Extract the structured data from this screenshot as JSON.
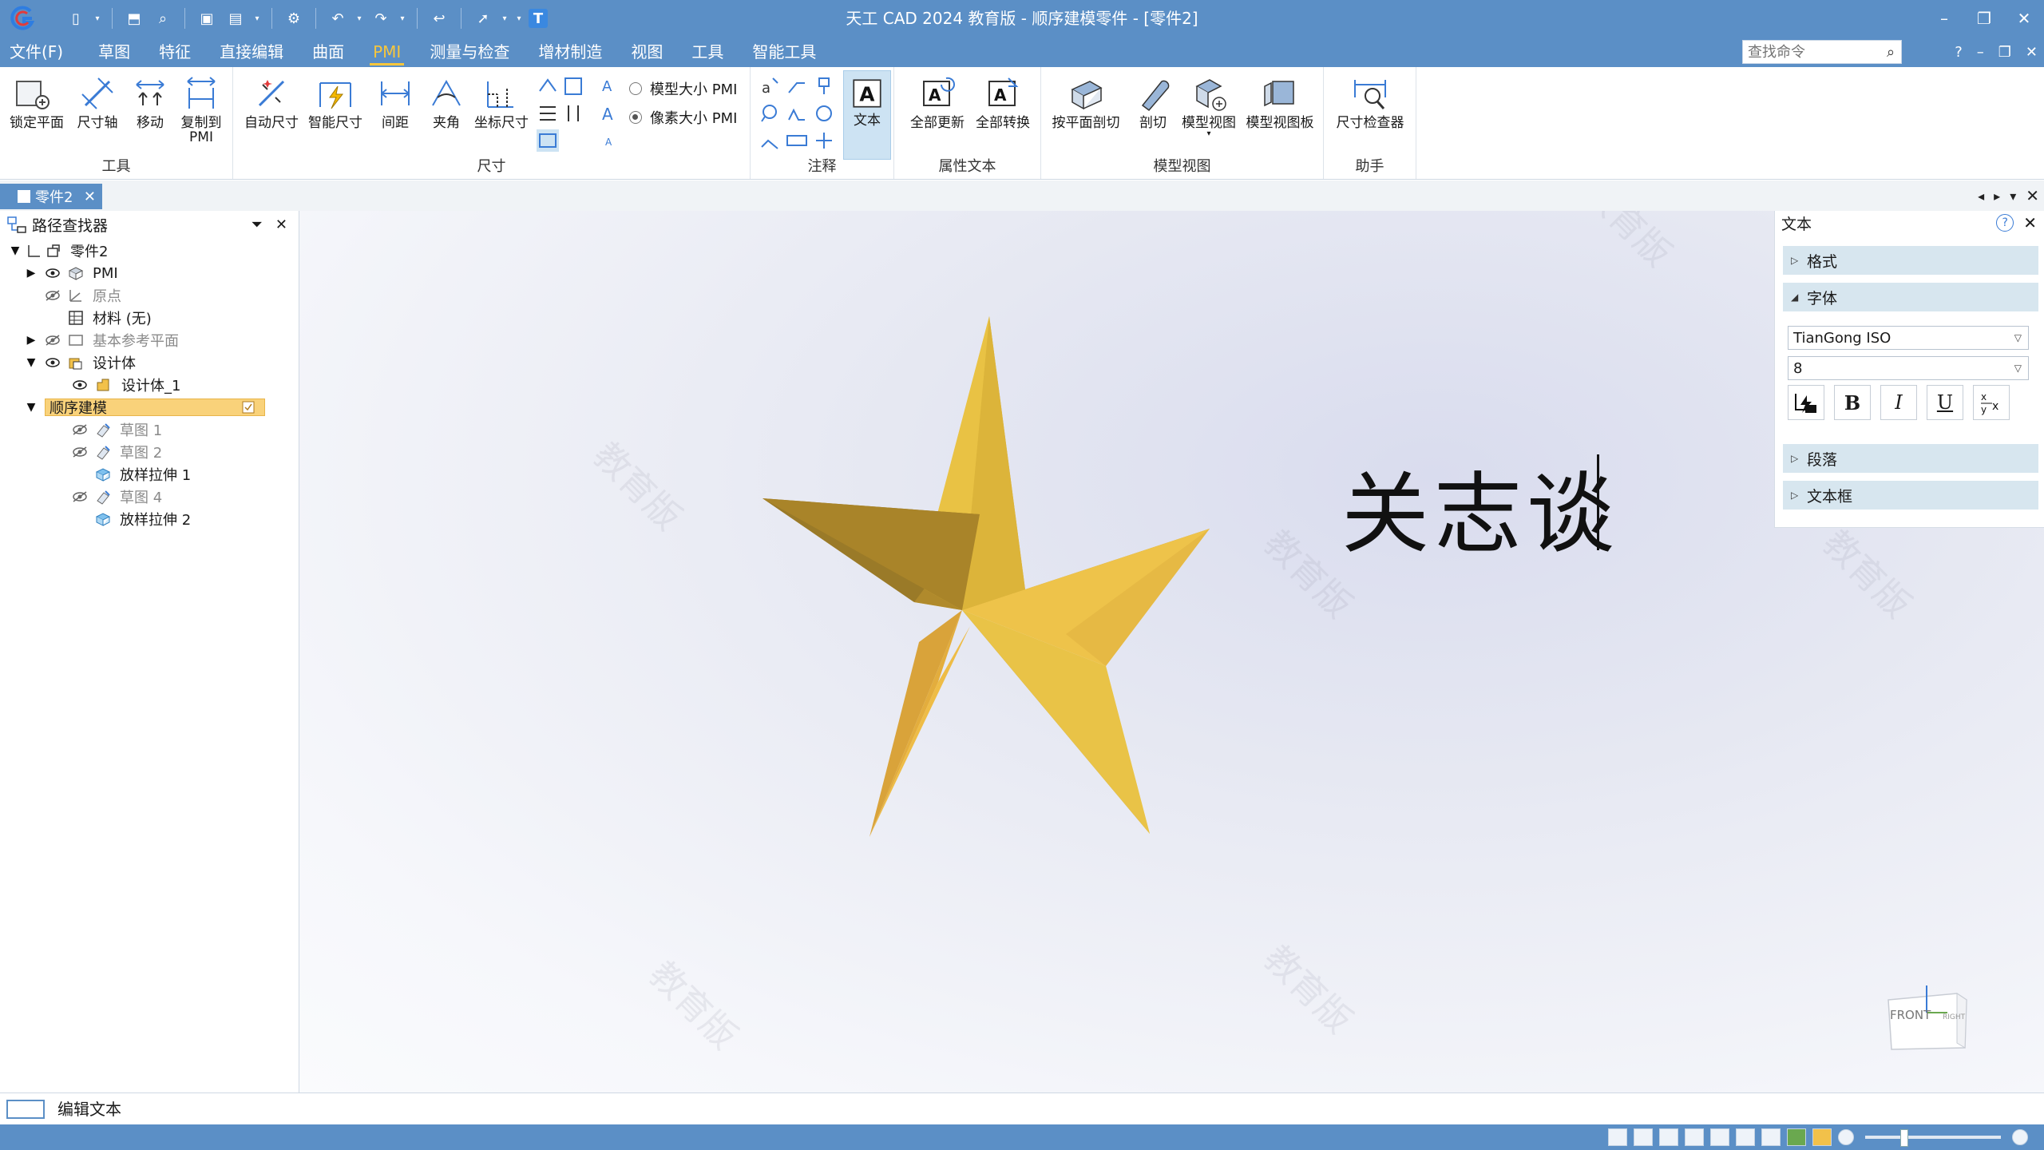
{
  "titlebar": {
    "title": "天工 CAD 2024 教育版 - 顺序建模零件 - [零件2]",
    "quick_access_icons": [
      "new-icon",
      "open-icon",
      "find-icon",
      "save-icon",
      "save-all-icon",
      "options-icon",
      "undo-icon",
      "redo-icon",
      "back-icon",
      "select-icon",
      "customize-icon",
      "text-tool-icon"
    ],
    "window_controls": {
      "minimize": "–",
      "restore": "❐",
      "close": "✕"
    }
  },
  "menubar": {
    "tabs": [
      {
        "label": "文件(F)"
      },
      {
        "label": "草图"
      },
      {
        "label": "特征"
      },
      {
        "label": "直接编辑"
      },
      {
        "label": "曲面"
      },
      {
        "label": "PMI",
        "active": true
      },
      {
        "label": "测量与检查"
      },
      {
        "label": "增材制造"
      },
      {
        "label": "视图"
      },
      {
        "label": "工具"
      },
      {
        "label": "智能工具"
      }
    ],
    "search_placeholder": "查找命令",
    "right_controls": [
      "?",
      "–",
      "❐",
      "✕"
    ]
  },
  "ribbon": {
    "groups": {
      "tools": {
        "label": "工具",
        "buttons": [
          "锁定平面",
          "尺寸轴",
          "移动",
          "复制到",
          "PMI"
        ]
      },
      "dimension": {
        "label": "尺寸",
        "buttons": [
          "自动尺寸",
          "智能尺寸",
          "间距",
          "夹角",
          "坐标尺寸"
        ],
        "radio_model": "模型大小 PMI",
        "radio_pixel": "像素大小 PMI"
      },
      "annotation": {
        "label": "注释",
        "text_button": "文本"
      },
      "attribute_text": {
        "label": "属性文本",
        "buttons": [
          "全部更新",
          "全部转换"
        ]
      },
      "model_view": {
        "label": "模型视图",
        "buttons": [
          "按平面剖切",
          "剖切",
          "模型视图",
          "模型视图板"
        ]
      },
      "assistant": {
        "label": "助手",
        "buttons": [
          "尺寸检查器"
        ]
      }
    }
  },
  "doc_tab": {
    "label": "零件2"
  },
  "pathfinder": {
    "title": "路径查找器",
    "items": [
      {
        "label": "零件2"
      },
      {
        "label": "PMI"
      },
      {
        "label": "原点"
      },
      {
        "label": "材料 (无)"
      },
      {
        "label": "基本参考平面"
      },
      {
        "label": "设计体"
      },
      {
        "label": "设计体_1"
      },
      {
        "label": "顺序建模"
      },
      {
        "label": "草图 1"
      },
      {
        "label": "草图 2"
      },
      {
        "label": "放样拉伸 1"
      },
      {
        "label": "草图 4"
      },
      {
        "label": "放样拉伸 2"
      }
    ]
  },
  "viewport": {
    "text": "关志谈",
    "watermark": "教育版",
    "viewcube_front": "FRONT",
    "viewcube_right": "RIGHT",
    "star_colors": {
      "light": "#f3cf4a",
      "mid": "#d9a93a",
      "dark": "#9a7a28",
      "shade": "#c9962f"
    }
  },
  "text_panel": {
    "title": "文本",
    "sections": {
      "format": "格式",
      "font": "字体",
      "paragraph": "段落",
      "textbox": "文本框"
    },
    "font_name": "TianGong ISO",
    "font_size": "8",
    "format_buttons": [
      "B",
      "I",
      "U"
    ]
  },
  "command_bar": {
    "text": "编辑文本"
  },
  "colors": {
    "accent": "#5b8fc6",
    "active_tab": "#f7c63c",
    "highlight": "#f9d27a"
  }
}
